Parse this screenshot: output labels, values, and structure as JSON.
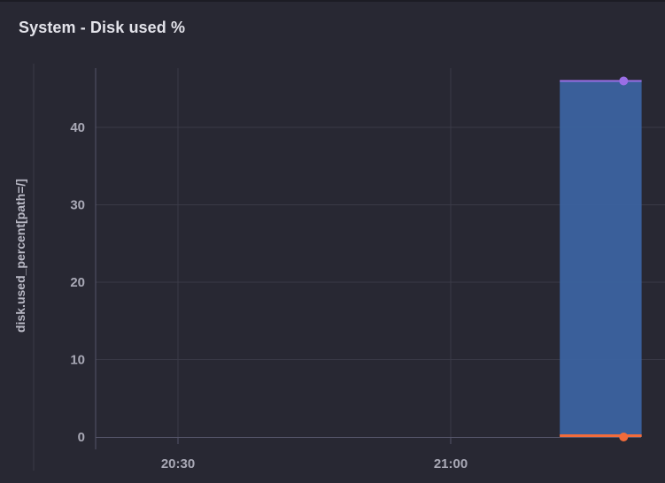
{
  "panel": {
    "title": "System - Disk used %"
  },
  "chart_data": {
    "type": "area",
    "title": "System - Disk used %",
    "ylabel": "disk.used_percent[path=/]",
    "xlabel": "",
    "ylim": [
      0,
      50
    ],
    "yticks": [
      0,
      10,
      20,
      30,
      40
    ],
    "xticks": [
      "20:30",
      "21:00"
    ],
    "grid": true,
    "series": [
      {
        "color": "#9a6ee6",
        "fill": "#3b62a0",
        "x": [
          "21:12",
          "21:21"
        ],
        "values": [
          46,
          46
        ]
      },
      {
        "color": "#f26b3a",
        "fill": "#f26b3a",
        "x": [
          "21:12",
          "21:21"
        ],
        "values": [
          0.2,
          0.2
        ]
      }
    ]
  }
}
